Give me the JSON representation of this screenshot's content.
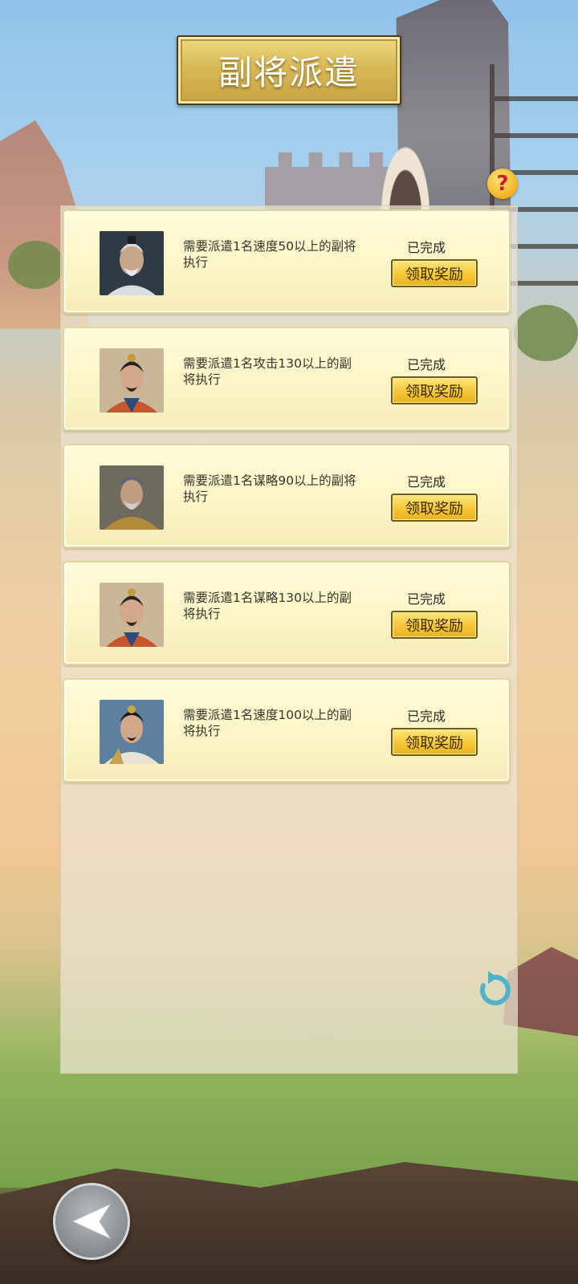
{
  "header": {
    "title": "副将派遣"
  },
  "help": {
    "icon": "help-question-icon",
    "glyph": "?"
  },
  "tasks": [
    {
      "portrait": "portrait-white-haired-strategist",
      "description": "需要派遣1名速度50以上的副将执行",
      "status": "已完成",
      "button": "领取奖励"
    },
    {
      "portrait": "portrait-red-robed-general",
      "description": "需要派遣1名攻击130以上的副将执行",
      "status": "已完成",
      "button": "领取奖励"
    },
    {
      "portrait": "portrait-armored-elder-general",
      "description": "需要派遣1名谋略90以上的副将执行",
      "status": "已完成",
      "button": "领取奖励"
    },
    {
      "portrait": "portrait-red-robed-general",
      "description": "需要派遣1名谋略130以上的副将执行",
      "status": "已完成",
      "button": "领取奖励"
    },
    {
      "portrait": "portrait-young-warrior",
      "description": "需要派遣1名速度100以上的副将执行",
      "status": "已完成",
      "button": "领取奖励"
    }
  ],
  "controls": {
    "refresh_icon": "refresh-icon",
    "back_icon": "back-arrow-icon"
  },
  "colors": {
    "accent_gold": "#f6c93a",
    "card_bg": "#fdf6c9",
    "refresh_teal": "#4fb3c9"
  }
}
